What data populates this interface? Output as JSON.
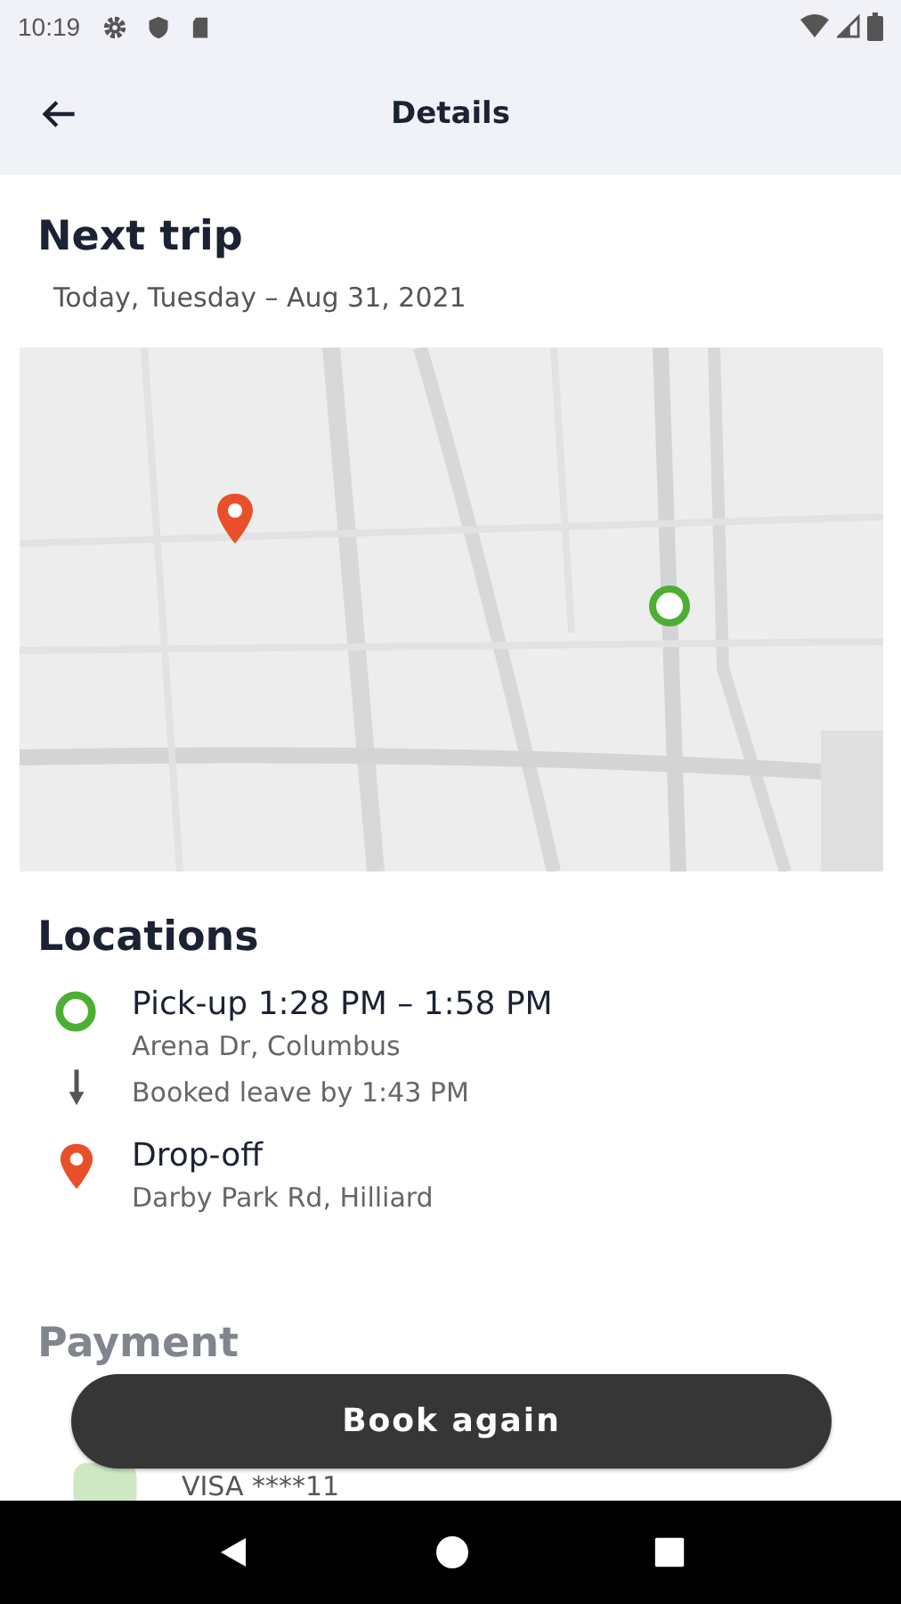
{
  "status_bar": {
    "time": "10:19"
  },
  "app_bar": {
    "title": "Details"
  },
  "trip": {
    "heading": "Next trip",
    "date": "Today, Tuesday – Aug 31, 2021"
  },
  "locations": {
    "heading": "Locations",
    "items": [
      {
        "kind": "pickup",
        "title": "Pick-up 1:28 PM – 1:58 PM",
        "address": "Arena Dr, Columbus",
        "note": "Booked leave by 1:43 PM"
      },
      {
        "kind": "dropoff",
        "title": "Drop-off",
        "address": "Darby Park Rd, Hilliard"
      }
    ]
  },
  "payment": {
    "heading": "Payment",
    "card": "VISA ****11"
  },
  "action": {
    "label": "Book again"
  }
}
